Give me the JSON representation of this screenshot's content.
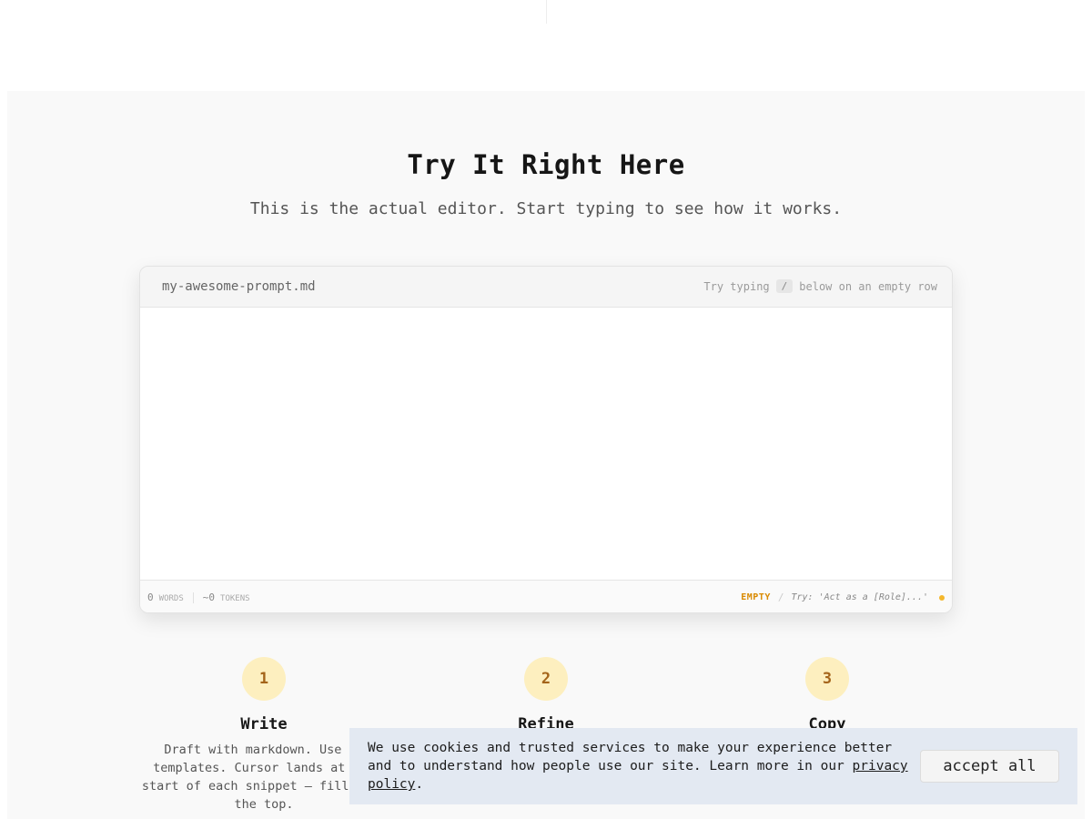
{
  "hero": {
    "title": "Try It Right Here",
    "subtitle": "This is the actual editor. Start typing to see how it works."
  },
  "editor": {
    "filename": "my-awesome-prompt.md",
    "hint_before": "Try typing",
    "hint_key": "/",
    "hint_after": "below on an empty row",
    "content": "",
    "footer": {
      "words_count": "0",
      "words_label": "WORDS",
      "tokens_count": "~0",
      "tokens_label": "TOKENS",
      "status": "EMPTY",
      "separator": "/",
      "try_hint": "Try: 'Act as a [Role]...'"
    }
  },
  "steps": [
    {
      "number": "1",
      "title": "Write",
      "desc_before": "Draft with markdown. Use",
      "desc_code": "/",
      "desc_after": "templates. Cursor lands at the start of each snippet — fill from the top."
    },
    {
      "number": "2",
      "title": "Refine"
    },
    {
      "number": "3",
      "title": "Copy"
    }
  ],
  "cookie": {
    "text": "We use cookies and trusted services to make your experience better and to understand how people use our site. Learn more in our",
    "link": "privacy policy",
    "end": ".",
    "accept": "accept all"
  },
  "colors": {
    "accent": "#f4b72c",
    "step_circle": "#fdefbf",
    "step_number": "#a4641a",
    "status_empty": "#d98a00",
    "cookie_bg": "#e3e9f2"
  }
}
